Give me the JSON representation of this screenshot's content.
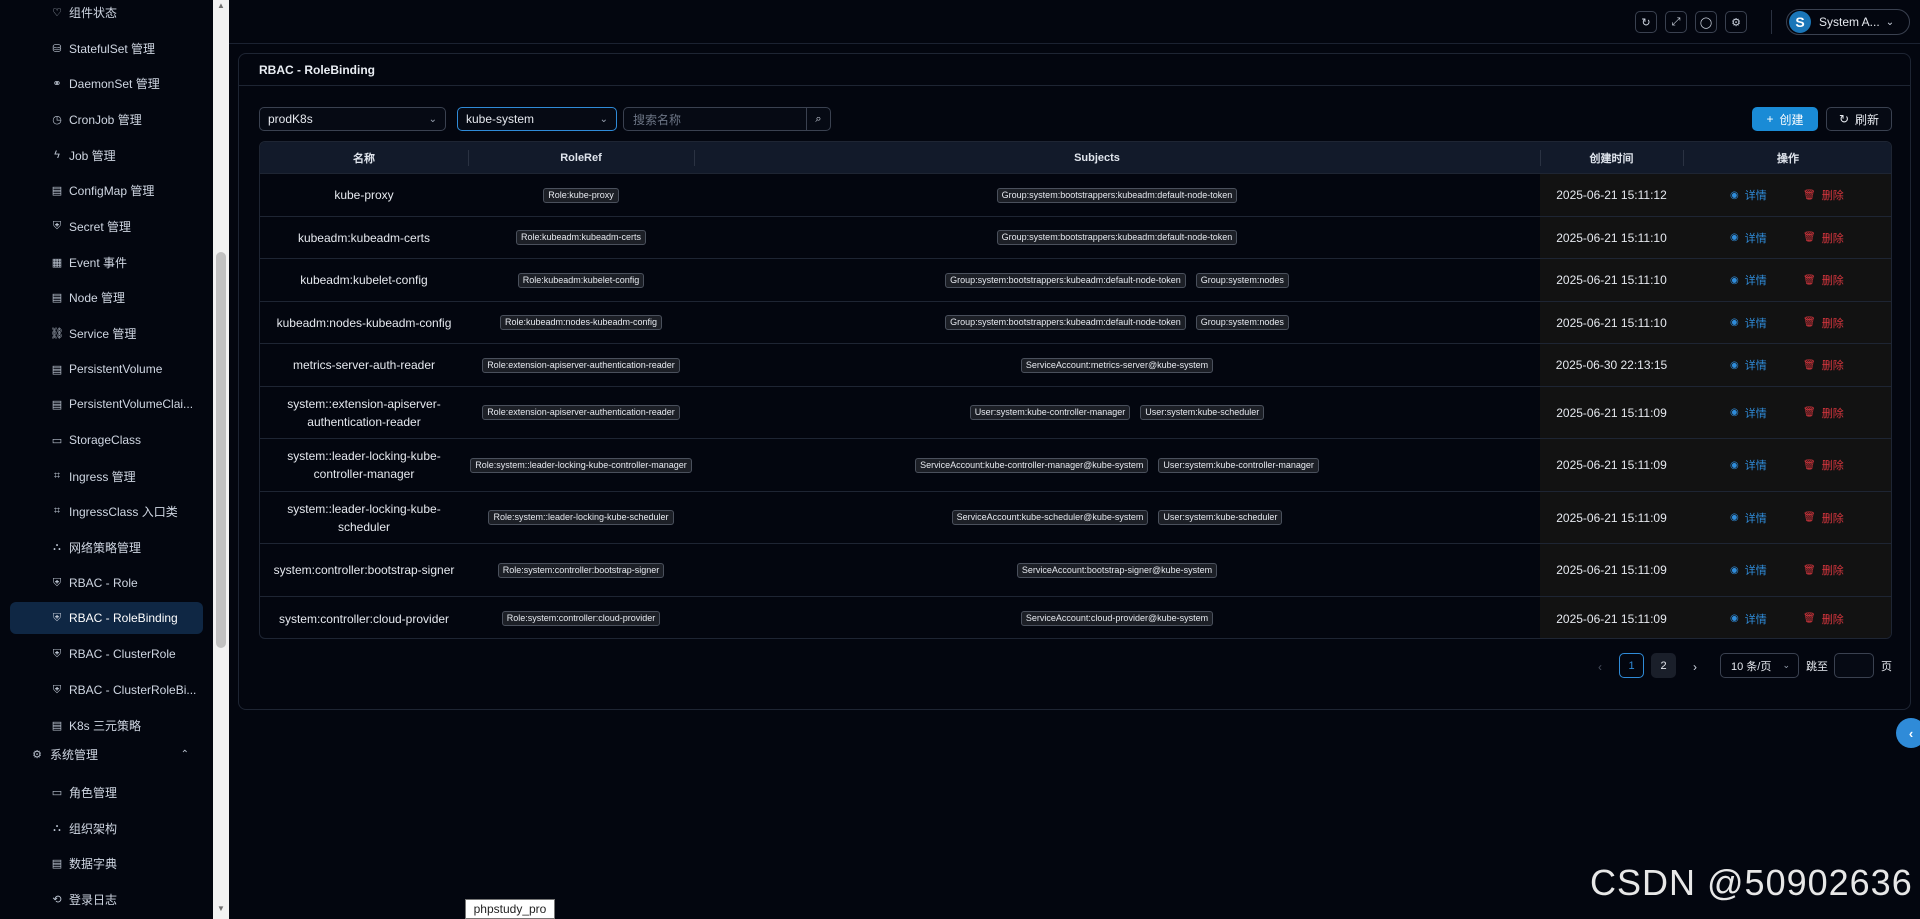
{
  "sidebar": {
    "items": [
      {
        "label": "组件状态",
        "icon": "heart-icon",
        "glyph": "♡"
      },
      {
        "label": "StatefulSet 管理",
        "icon": "stateful-icon",
        "glyph": "⛁"
      },
      {
        "label": "DaemonSet 管理",
        "icon": "link-icon",
        "glyph": "⚭"
      },
      {
        "label": "CronJob 管理",
        "icon": "clock-icon",
        "glyph": "◷"
      },
      {
        "label": "Job 管理",
        "icon": "bolt-icon",
        "glyph": "ϟ"
      },
      {
        "label": "ConfigMap 管理",
        "icon": "file-icon",
        "glyph": "▤"
      },
      {
        "label": "Secret 管理",
        "icon": "shield-icon",
        "glyph": "⛨"
      },
      {
        "label": "Event 事件",
        "icon": "event-icon",
        "glyph": "▦"
      },
      {
        "label": "Node 管理",
        "icon": "node-icon",
        "glyph": "▤"
      },
      {
        "label": "Service 管理",
        "icon": "service-icon",
        "glyph": "⛓"
      },
      {
        "label": "PersistentVolume",
        "icon": "volume-icon",
        "glyph": "▤"
      },
      {
        "label": "PersistentVolumeClai...",
        "icon": "volume-claim-icon",
        "glyph": "▤"
      },
      {
        "label": "StorageClass",
        "icon": "folder-icon",
        "glyph": "▭"
      },
      {
        "label": "Ingress 管理",
        "icon": "ingress-icon",
        "glyph": "⌗"
      },
      {
        "label": "IngressClass 入口类",
        "icon": "ingress-class-icon",
        "glyph": "⌗"
      },
      {
        "label": "网络策略管理",
        "icon": "network-icon",
        "glyph": "⛬"
      },
      {
        "label": "RBAC - Role",
        "icon": "shield-check-icon",
        "glyph": "⛨"
      },
      {
        "label": "RBAC - RoleBinding",
        "icon": "shield-check-icon",
        "glyph": "⛨",
        "active": true
      },
      {
        "label": "RBAC - ClusterRole",
        "icon": "shield-check-icon",
        "glyph": "⛨"
      },
      {
        "label": "RBAC - ClusterRoleBi...",
        "icon": "shield-check-icon",
        "glyph": "⛨"
      },
      {
        "label": "K8s 三元策略",
        "icon": "policy-icon",
        "glyph": "▤"
      }
    ],
    "group": {
      "label": "系统管理",
      "icon": "gear-icon",
      "glyph": "⚙",
      "chevron": "⌃"
    },
    "sub_items": [
      {
        "label": "角色管理",
        "icon": "role-icon",
        "glyph": "▭"
      },
      {
        "label": "组织架构",
        "icon": "org-icon",
        "glyph": "⛬"
      },
      {
        "label": "数据字典",
        "icon": "dict-icon",
        "glyph": "▤"
      },
      {
        "label": "登录日志",
        "icon": "log-icon",
        "glyph": "⟲"
      }
    ]
  },
  "header": {
    "buttons": [
      {
        "name": "refresh-icon",
        "glyph": "↻"
      },
      {
        "name": "fullscreen-icon",
        "glyph": "⤢"
      },
      {
        "name": "bulb-icon",
        "glyph": "◯"
      },
      {
        "name": "settings-icon",
        "glyph": "⚙"
      }
    ],
    "user": {
      "initial": "S",
      "name": "System A...",
      "chevron": "⌄"
    }
  },
  "card": {
    "title": "RBAC - RoleBinding"
  },
  "toolbar": {
    "cluster_select": "prodK8s",
    "namespace_select": "kube-system",
    "search_placeholder": "搜索名称",
    "search_icon": "⌕",
    "create_label": "创建",
    "create_icon": "+",
    "refresh_label": "刷新",
    "refresh_icon": "↻",
    "select_arrow": "⌄"
  },
  "table": {
    "columns": [
      "名称",
      "RoleRef",
      "Subjects",
      "创建时间",
      "操作"
    ],
    "detail_label": "详情",
    "delete_label": "删除",
    "detail_icon": "◉",
    "delete_icon": "🗑",
    "rows": [
      {
        "name": "kube-proxy",
        "roleref": "Role:kube-proxy",
        "subjects": [
          "Group:system:bootstrappers:kubeadm:default-node-token"
        ],
        "created": "2025-06-21 15:11:12"
      },
      {
        "name": "kubeadm:kubeadm-certs",
        "roleref": "Role:kubeadm:kubeadm-certs",
        "subjects": [
          "Group:system:bootstrappers:kubeadm:default-node-token"
        ],
        "created": "2025-06-21 15:11:10"
      },
      {
        "name": "kubeadm:kubelet-config",
        "roleref": "Role:kubeadm:kubelet-config",
        "subjects": [
          "Group:system:bootstrappers:kubeadm:default-node-token",
          "Group:system:nodes"
        ],
        "created": "2025-06-21 15:11:10"
      },
      {
        "name": "kubeadm:nodes-kubeadm-config",
        "roleref": "Role:kubeadm:nodes-kubeadm-config",
        "subjects": [
          "Group:system:bootstrappers:kubeadm:default-node-token",
          "Group:system:nodes"
        ],
        "created": "2025-06-21 15:11:10"
      },
      {
        "name": "metrics-server-auth-reader",
        "roleref": "Role:extension-apiserver-authentication-reader",
        "subjects": [
          "ServiceAccount:metrics-server@kube-system"
        ],
        "created": "2025-06-30 22:13:15"
      },
      {
        "name": "system::extension-apiserver-authentication-reader",
        "roleref": "Role:extension-apiserver-authentication-reader",
        "subjects": [
          "User:system:kube-controller-manager",
          "User:system:kube-scheduler"
        ],
        "created": "2025-06-21 15:11:09"
      },
      {
        "name": "system::leader-locking-kube-controller-manager",
        "roleref": "Role:system::leader-locking-kube-controller-manager",
        "subjects": [
          "ServiceAccount:kube-controller-manager@kube-system",
          "User:system:kube-controller-manager"
        ],
        "created": "2025-06-21 15:11:09"
      },
      {
        "name": "system::leader-locking-kube-scheduler",
        "roleref": "Role:system::leader-locking-kube-scheduler",
        "subjects": [
          "ServiceAccount:kube-scheduler@kube-system",
          "User:system:kube-scheduler"
        ],
        "created": "2025-06-21 15:11:09"
      },
      {
        "name": "system:controller:bootstrap-signer",
        "roleref": "Role:system:controller:bootstrap-signer",
        "subjects": [
          "ServiceAccount:bootstrap-signer@kube-system"
        ],
        "created": "2025-06-21 15:11:09"
      },
      {
        "name": "system:controller:cloud-provider",
        "roleref": "Role:system:controller:cloud-provider",
        "subjects": [
          "ServiceAccount:cloud-provider@kube-system"
        ],
        "created": "2025-06-21 15:11:09"
      }
    ]
  },
  "pagination": {
    "prev": "‹",
    "next": "›",
    "pages": [
      "1",
      "2"
    ],
    "current": "1",
    "page_size": "10 条/页",
    "size_arrow": "⌄",
    "jump_prefix": "跳至",
    "jump_suffix": "页"
  },
  "float_toggle": "‹",
  "tooltip": "phpstudy_pro",
  "watermark": "CSDN @50902636",
  "colors": {
    "accent": "#1a8bd6",
    "danger": "#d9363e",
    "link": "#2f8bd8",
    "background": "#03060f"
  }
}
